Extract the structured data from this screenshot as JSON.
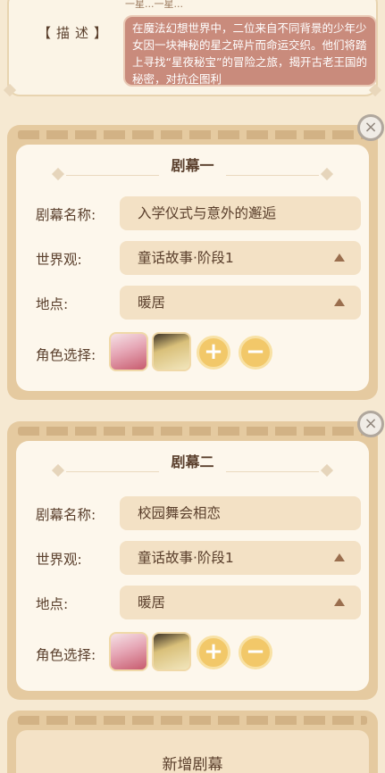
{
  "description": {
    "top_fragment": "一星...一星...",
    "label": "【描述】",
    "text": "在魔法幻想世界中，二位来自不同背景的少年少女因一块神秘的星之碎片而命运交织。他们将踏上寻找“星夜秘宝”的冒险之旅，揭开古老王国的秘密，对抗企图利"
  },
  "acts": [
    {
      "title": "剧幕一",
      "name_label": "剧幕名称:",
      "name_value": "入学仪式与意外的邂逅",
      "world_label": "世界观:",
      "world_value": "童话故事·阶段1",
      "location_label": "地点:",
      "location_value": "暖居",
      "roles_label": "角色选择:",
      "add_symbol": "+",
      "remove_symbol": "−",
      "close_symbol": "×"
    },
    {
      "title": "剧幕二",
      "name_label": "剧幕名称:",
      "name_value": "校园舞会相恋",
      "world_label": "世界观:",
      "world_value": "童话故事·阶段1",
      "location_label": "地点:",
      "location_value": "暖居",
      "roles_label": "角色选择:",
      "add_symbol": "+",
      "remove_symbol": "−",
      "close_symbol": "×"
    }
  ],
  "add_act_label": "新增剧幕",
  "icons": {
    "dropdown": "caret-up-icon",
    "close": "close-icon",
    "add": "plus-icon",
    "remove": "minus-icon"
  },
  "colors": {
    "background": "#f6e9d2",
    "card_frame": "#e5caa0",
    "desc_box": "#c98b7c",
    "button_gold": "#f2c869"
  }
}
